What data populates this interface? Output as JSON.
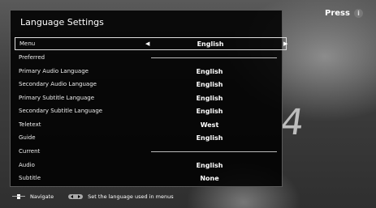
{
  "badge": {
    "label": "Press",
    "icon": "info-icon"
  },
  "panel": {
    "title": "Language Settings"
  },
  "menu_row": {
    "label": "Menu",
    "value": "English"
  },
  "sections": {
    "preferred": "Preferred",
    "current": "Current"
  },
  "preferred_rows": [
    {
      "label": "Primary Audio Language",
      "value": "English"
    },
    {
      "label": "Secondary Audio Language",
      "value": "English"
    },
    {
      "label": "Primary Subtitle Language",
      "value": "English"
    },
    {
      "label": "Secondary Subtitle Language",
      "value": "English"
    },
    {
      "label": "Teletext",
      "value": "West"
    },
    {
      "label": "Guide",
      "value": "English"
    }
  ],
  "current_rows": [
    {
      "label": "Audio",
      "value": "English"
    },
    {
      "label": "Subtitle",
      "value": "None"
    }
  ],
  "footer": {
    "navigate_label": "Navigate",
    "hint_label": "Set the language used in menus"
  },
  "background": {
    "glyph": "4"
  },
  "colors": {
    "panel": "#000000",
    "selected_border": "#dddddd",
    "background": "#3c3c3c"
  }
}
